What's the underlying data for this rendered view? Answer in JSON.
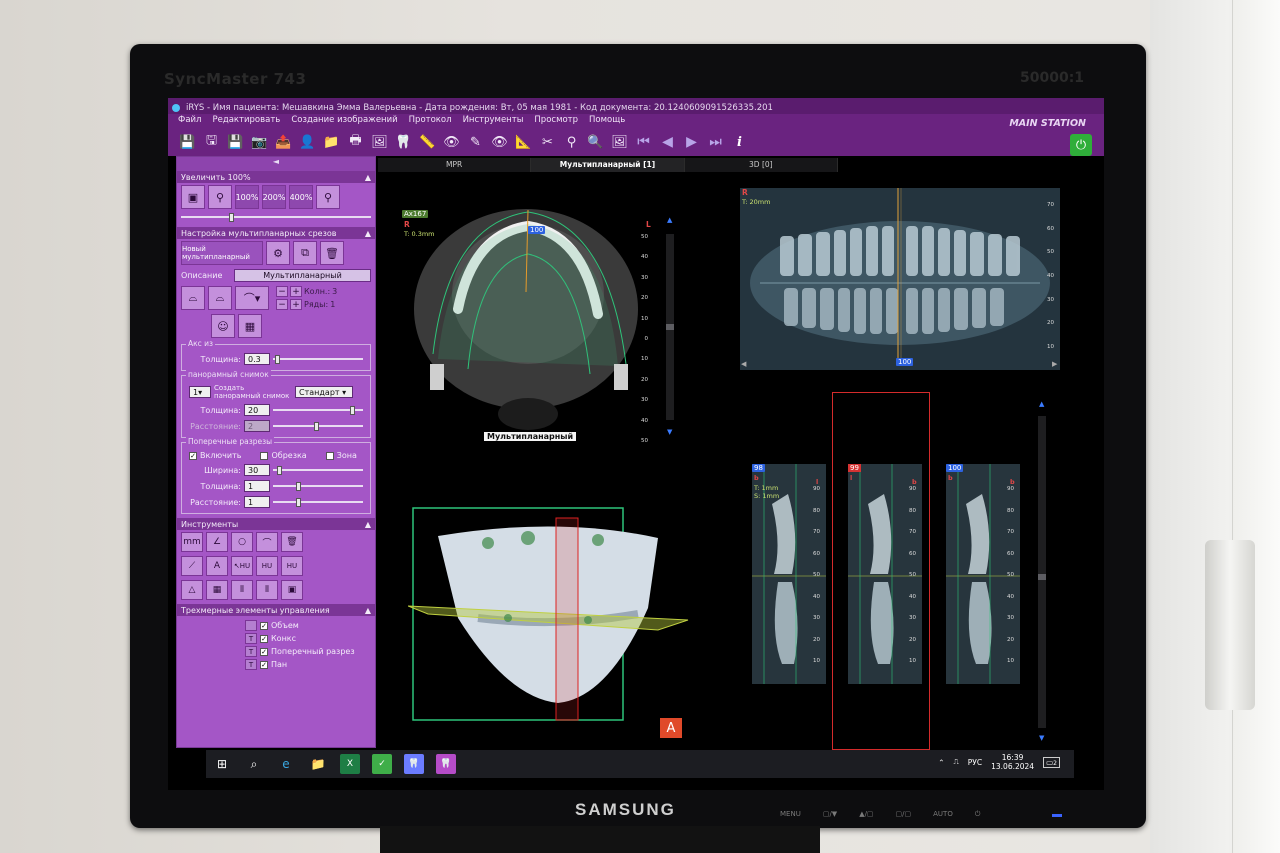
{
  "bezel": {
    "model": "SyncMaster 743",
    "contrast": "50000:1",
    "brand": "SAMSUNG",
    "buttons": [
      "MENU",
      "▢/▼",
      "▲/▢",
      "▢/▢",
      "AUTO",
      "⏻"
    ]
  },
  "app": {
    "title": "iRYS - Имя пациента: Мешавкина Эмма Валерьевна - Дата рождения: Вт, 05 мая 1981 - Код документа: 20.1240609091526335.201",
    "station": "MAIN STATION",
    "menu": [
      "Файл",
      "Редактировать",
      "Создание изображений",
      "Протокол",
      "Инструменты",
      "Просмотр",
      "Помощь"
    ]
  },
  "toolbar": {
    "icons": [
      "save-icon",
      "save-as-icon",
      "save-disk-icon",
      "camera-icon",
      "export-icon",
      "patient-icon",
      "folder-icon",
      "print-icon",
      "image-icon",
      "tooth-icon",
      "measure-icon",
      "eye-icon",
      "pen-icon",
      "eye-off-icon",
      "ruler-icon",
      "scissors-icon",
      "implant-icon",
      "magnify-tool-icon",
      "screenshot-icon"
    ],
    "icon_glyphs": [
      "💾",
      "🖫",
      "💾",
      "📷",
      "📤",
      "👤",
      "📁",
      "🖶",
      "🖼",
      "🦷",
      "📏",
      "👁",
      "✎",
      "👁",
      "📐",
      "✂",
      "⚲",
      "🔍",
      "🖼"
    ],
    "nav": [
      "⏮",
      "◀",
      "▶",
      "⏭"
    ],
    "info": "i",
    "power": "⏻"
  },
  "leftpanel": {
    "collapse": "◄",
    "zoom_head": "Увеличить 100%",
    "zoom_buttons": [
      "100%",
      "200%",
      "400%"
    ],
    "mpr_head": "Настройка мультипланарных срезов",
    "new_mpr": "Новый мультипланарный",
    "desc_label": "Описание",
    "desc_value": "Мультипланарный",
    "cols_label": "Колн.:",
    "cols_value": "3",
    "rows_label": "Ряды:",
    "rows_value": "1",
    "axis_legend": "Акс из",
    "axis_thickness_label": "Толщина:",
    "axis_thickness_value": "0.3",
    "pano_legend": "панорамный снимок",
    "pano_count": "1",
    "pano_create_label": "Создать панорамный снимок",
    "pano_mode": "Стандарт",
    "pano_thickness_label": "Толщина:",
    "pano_thickness_value": "20",
    "pano_distance_label": "Расстояние:",
    "pano_distance_value": "2",
    "cross_legend": "Поперечные разрезы",
    "cross_enable": "Включить",
    "cross_crop": "Обрезка",
    "cross_zone": "Зона",
    "cross_width_label": "Ширина:",
    "cross_width_value": "30",
    "cross_thickness_label": "Толщина:",
    "cross_thickness_value": "1",
    "cross_distance_label": "Расстояние:",
    "cross_distance_value": "1",
    "tools_head": "Инструменты",
    "tools_row1": [
      "mm",
      "∠",
      "○",
      "⌒",
      "🗑"
    ],
    "tools_row2": [
      "⟋",
      "A",
      "↖HU",
      "HU",
      "HU"
    ],
    "tools_row3": [
      "△",
      "▦",
      "⫴",
      "⫴",
      "▣"
    ],
    "threed_head": "Трехмерные элементы управления",
    "threed_items": [
      {
        "mark": "",
        "label": "Объем",
        "checked": "✓"
      },
      {
        "mark": "T",
        "label": "Конкс",
        "checked": "✓"
      },
      {
        "mark": "T",
        "label": "Поперечный разрез",
        "checked": "✓"
      },
      {
        "mark": "T",
        "label": "Пан",
        "checked": "✓"
      }
    ]
  },
  "tabs": [
    "MPR",
    "Мультипланарный  [1]",
    "3D  [0]"
  ],
  "axial": {
    "badge": "Ax167",
    "orient": "R",
    "thickness": "T: 0.3mm",
    "slice": "100",
    "caption": "Мультипланарный",
    "side": "L",
    "ruler": [
      "50",
      "40",
      "30",
      "20",
      "10",
      "0",
      "10",
      "20",
      "30",
      "40",
      "50"
    ]
  },
  "pano": {
    "orient": "R",
    "thickness": "T: 20mm",
    "slice": "100",
    "ruler": [
      "70",
      "60",
      "50",
      "40",
      "30",
      "20",
      "10"
    ]
  },
  "cross": [
    {
      "num": "98",
      "orient": "b",
      "side": "l",
      "t": "T: 1mm",
      "s": "S: 1mm"
    },
    {
      "num": "99",
      "orient": "l",
      "side": "b",
      "t": "",
      "s": ""
    },
    {
      "num": "100",
      "orient": "b",
      "side": "b",
      "t": "",
      "s": ""
    }
  ],
  "cross_ruler": [
    "90",
    "80",
    "70",
    "60",
    "50",
    "40",
    "30",
    "20",
    "10"
  ],
  "three_d": {
    "marker": "A"
  },
  "taskbar": {
    "apps": [
      "⊞",
      "⌕",
      "e",
      "📁",
      "X",
      "✓",
      "🦷",
      "🦷"
    ],
    "lang": "РУС",
    "time": "16:39",
    "date": "13.06.2024",
    "notif": "2"
  }
}
